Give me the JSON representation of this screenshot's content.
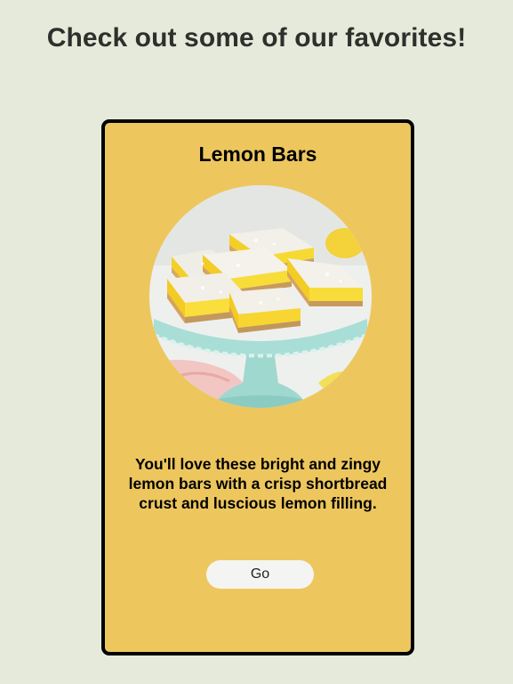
{
  "page": {
    "heading": "Check out some of our favorites!"
  },
  "card": {
    "title": "Lemon Bars",
    "image_alt": "Lemon bars dusted with powdered sugar on a mint cake stand",
    "description": "You'll love these bright and zingy lemon bars with a crisp shortbread crust and luscious lemon filling.",
    "button_label": "Go"
  },
  "colors": {
    "background": "#e6eadb",
    "card_background": "#edc75e",
    "card_border": "#000000",
    "button_background": "#f4f4f2"
  }
}
